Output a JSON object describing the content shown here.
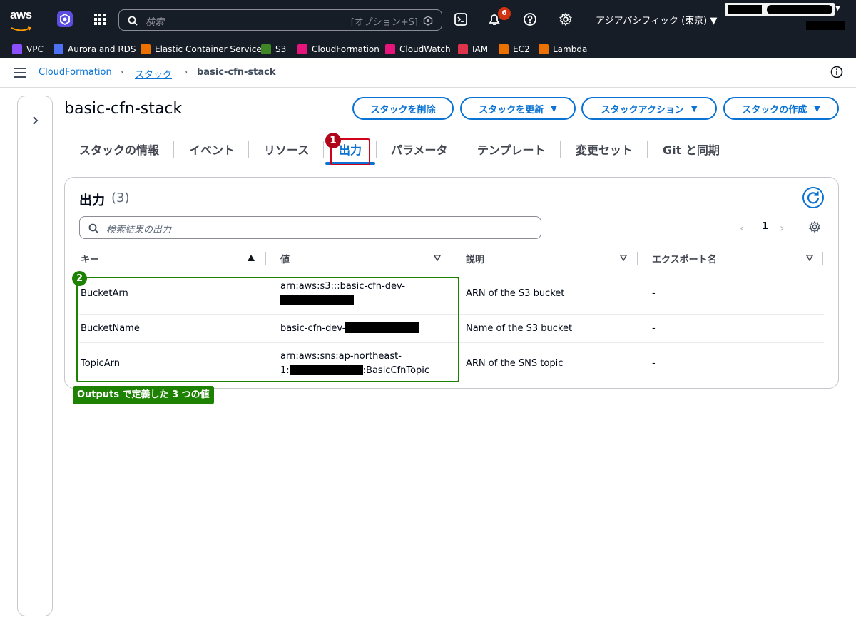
{
  "topbar": {
    "search_placeholder": "検索",
    "search_shortcut": "[オプション+S]",
    "notification_count": "6",
    "region": "アジアパシフィック (東京) ▼"
  },
  "favorites": [
    {
      "label": "VPC",
      "color": "#8c4fff"
    },
    {
      "label": "Aurora and RDS",
      "color": "#4d72f3"
    },
    {
      "label": "Elastic Container Service",
      "color": "#ed7100"
    },
    {
      "label": "S3",
      "color": "#3f8624"
    },
    {
      "label": "CloudFormation",
      "color": "#e7157b"
    },
    {
      "label": "CloudWatch",
      "color": "#e7157b"
    },
    {
      "label": "IAM",
      "color": "#dd344c"
    },
    {
      "label": "EC2",
      "color": "#ed7100"
    },
    {
      "label": "Lambda",
      "color": "#ed7100"
    }
  ],
  "breadcrumb": {
    "root": "CloudFormation",
    "parent": "スタック",
    "current": "basic-cfn-stack"
  },
  "page": {
    "title": "basic-cfn-stack",
    "buttons": {
      "delete": "スタックを削除",
      "update": "スタックを更新",
      "actions": "スタックアクション",
      "create": "スタックの作成"
    }
  },
  "tabs": [
    "スタックの情報",
    "イベント",
    "リソース",
    "出力",
    "パラメータ",
    "テンプレート",
    "変更セット",
    "Git と同期"
  ],
  "outputs": {
    "title": "出力",
    "count": "(3)",
    "search_placeholder": "検索結果の出力",
    "page": "1",
    "columns": [
      "キー",
      "値",
      "説明",
      "エクスポート名"
    ],
    "rows": [
      {
        "key": "BucketArn",
        "value_a": "arn:aws:s3:::basic-cfn-dev-",
        "value_b": "",
        "description": "ARN of the S3 bucket",
        "export": "-"
      },
      {
        "key": "BucketName",
        "value_a": "basic-cfn-dev-",
        "value_b": "",
        "description": "Name of the S3 bucket",
        "export": "-"
      },
      {
        "key": "TopicArn",
        "value_a": "arn:aws:sns:ap-northeast-",
        "value_b": "1:",
        "value_c": ":BasicCfnTopic",
        "description": "ARN of the SNS topic",
        "export": "-"
      }
    ]
  },
  "annotations": {
    "marker1": "1",
    "marker2": "2",
    "label": "Outputs で定義した 3 つの値"
  },
  "colors": {
    "topbar": "#161d26",
    "accent": "#0972d3",
    "annotation_red": "#d0021b",
    "annotation_green": "#1d8102"
  }
}
